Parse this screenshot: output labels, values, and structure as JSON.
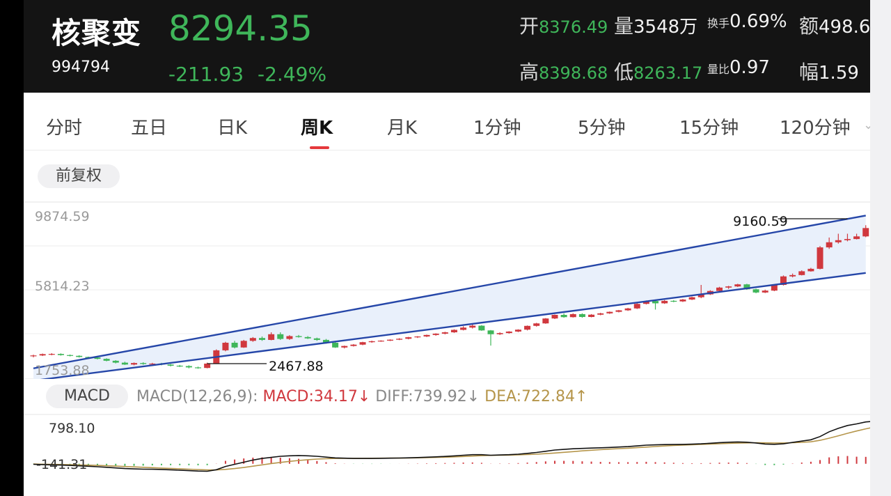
{
  "header": {
    "name": "核聚变",
    "code": "994794",
    "price": "8294.35",
    "change": "-211.93",
    "change_pct": "-2.49%",
    "stats": {
      "open_label": "开",
      "open_value": "8376.49",
      "volume_label": "量",
      "volume_value": "3548万",
      "turnover_label": "换手",
      "turnover_value": "0.69%",
      "amount_label": "额",
      "amount_value": "498.6",
      "high_label": "高",
      "high_value": "8398.68",
      "low_label": "低",
      "low_value": "8263.17",
      "vol_ratio_label": "量比",
      "vol_ratio_value": "0.97",
      "amplitude_label": "幅",
      "amplitude_value": "1.59"
    }
  },
  "tabs": [
    "分时",
    "五日",
    "日K",
    "周K",
    "月K",
    "1分钟",
    "5分钟",
    "15分钟",
    "120分钟"
  ],
  "active_tab": "周K",
  "adjust_label": "前复权",
  "macd_panel": {
    "button": "MACD",
    "params": "MACD(12,26,9):",
    "macd": "MACD:34.17",
    "diff": "DIFF:739.92",
    "dea": "DEA:722.84",
    "macd_color": "#d0383e",
    "diff_color": "#888888",
    "dea_color": "#b5954a"
  },
  "colors": {
    "up": "#d0383e",
    "down": "#3fb65a",
    "channel": "#2546a8",
    "channel_fill": "#e9f0fb"
  },
  "chart_data": [
    {
      "type": "candlestick",
      "title": "周K",
      "y_ticks": [
        "9874.59",
        "5814.23",
        "1753.88"
      ],
      "annotations": [
        {
          "text": "9160.59",
          "label": "high"
        },
        {
          "text": "2467.88",
          "label": "low"
        }
      ],
      "channel": {
        "lower": [
          [
            0,
            1150
          ],
          [
            91,
            6830
          ]
        ],
        "upper": [
          [
            0,
            1800
          ],
          [
            91,
            9860
          ]
        ]
      },
      "candles": [
        [
          2450,
          2480,
          2380,
          2520
        ],
        [
          2480,
          2550,
          2450,
          2580
        ],
        [
          2550,
          2560,
          2490,
          2600
        ],
        [
          2560,
          2500,
          2470,
          2590
        ],
        [
          2500,
          2460,
          2430,
          2530
        ],
        [
          2460,
          2400,
          2370,
          2490
        ],
        [
          2400,
          2370,
          2330,
          2420
        ],
        [
          2370,
          2300,
          2270,
          2400
        ],
        [
          2300,
          2200,
          2170,
          2330
        ],
        [
          2200,
          2100,
          2060,
          2230
        ],
        [
          2100,
          2000,
          1980,
          2150
        ],
        [
          2000,
          2080,
          1960,
          2110
        ],
        [
          2080,
          2030,
          1990,
          2120
        ],
        [
          2030,
          2050,
          1990,
          2090
        ],
        [
          2050,
          2000,
          1960,
          2090
        ],
        [
          2000,
          1940,
          1900,
          2030
        ],
        [
          1940,
          1920,
          1870,
          1980
        ],
        [
          1920,
          1850,
          1800,
          1960
        ],
        [
          1850,
          1820,
          1780,
          1890
        ],
        [
          1820,
          2050,
          1800,
          2100
        ],
        [
          2050,
          2750,
          2030,
          2800
        ],
        [
          2750,
          3150,
          2700,
          3200
        ],
        [
          3150,
          2900,
          2850,
          3250
        ],
        [
          2900,
          3250,
          2880,
          3300
        ],
        [
          3250,
          3400,
          3200,
          3450
        ],
        [
          3400,
          3300,
          3250,
          3480
        ],
        [
          3300,
          3600,
          3280,
          3700
        ],
        [
          3600,
          3350,
          3300,
          3700
        ],
        [
          3350,
          3500,
          3300,
          3550
        ],
        [
          3500,
          3450,
          3420,
          3560
        ],
        [
          3450,
          3380,
          3350,
          3500
        ],
        [
          3380,
          3300,
          3250,
          3420
        ],
        [
          3300,
          3150,
          3100,
          3350
        ],
        [
          3150,
          2900,
          2880,
          3180
        ],
        [
          2900,
          2980,
          2850,
          3000
        ],
        [
          2980,
          3050,
          2950,
          3080
        ],
        [
          3050,
          3180,
          3020,
          3200
        ],
        [
          3180,
          3230,
          3150,
          3260
        ],
        [
          3230,
          3260,
          3200,
          3280
        ],
        [
          3260,
          3310,
          3240,
          3330
        ],
        [
          3310,
          3360,
          3290,
          3390
        ],
        [
          3360,
          3440,
          3330,
          3460
        ],
        [
          3440,
          3480,
          3400,
          3500
        ],
        [
          3480,
          3560,
          3450,
          3580
        ],
        [
          3560,
          3630,
          3520,
          3650
        ],
        [
          3630,
          3700,
          3590,
          3730
        ],
        [
          3700,
          3830,
          3670,
          3860
        ],
        [
          3830,
          3950,
          3800,
          4020
        ],
        [
          3950,
          4050,
          3900,
          4120
        ],
        [
          4050,
          3800,
          3780,
          4080
        ],
        [
          3800,
          3600,
          3000,
          3820
        ],
        [
          3600,
          3660,
          3560,
          3700
        ],
        [
          3660,
          3740,
          3630,
          3760
        ],
        [
          3740,
          3840,
          3710,
          3860
        ],
        [
          3840,
          4040,
          3800,
          4060
        ],
        [
          4040,
          4170,
          4000,
          4200
        ],
        [
          4170,
          4430,
          4150,
          4450
        ],
        [
          4430,
          4620,
          4400,
          4640
        ],
        [
          4620,
          4500,
          4470,
          4700
        ],
        [
          4500,
          4660,
          4480,
          4700
        ],
        [
          4660,
          4510,
          4470,
          4700
        ],
        [
          4510,
          4630,
          4490,
          4660
        ],
        [
          4630,
          4700,
          4600,
          4730
        ],
        [
          4700,
          4780,
          4670,
          4800
        ],
        [
          4780,
          4860,
          4750,
          4880
        ],
        [
          4860,
          4960,
          4830,
          4990
        ],
        [
          4960,
          5200,
          4930,
          5230
        ],
        [
          5200,
          5350,
          5170,
          5380
        ],
        [
          5350,
          5230,
          4900,
          5400
        ],
        [
          5230,
          5360,
          5200,
          5400
        ],
        [
          5360,
          5330,
          5290,
          5400
        ],
        [
          5330,
          5430,
          5300,
          5460
        ],
        [
          5430,
          5550,
          5400,
          5580
        ],
        [
          5550,
          5700,
          5500,
          6200
        ],
        [
          5700,
          5880,
          5670,
          5920
        ],
        [
          5880,
          6060,
          5850,
          6100
        ],
        [
          6060,
          6120,
          5990,
          6150
        ],
        [
          6120,
          6230,
          6090,
          6260
        ],
        [
          6230,
          5970,
          5940,
          6260
        ],
        [
          5970,
          5800,
          5760,
          6000
        ],
        [
          5800,
          5900,
          5770,
          5950
        ],
        [
          5900,
          6200,
          5870,
          6230
        ],
        [
          6200,
          6650,
          6170,
          6700
        ],
        [
          6650,
          6720,
          6600,
          6800
        ],
        [
          6720,
          6920,
          6700,
          6970
        ],
        [
          6920,
          7050,
          6900,
          7100
        ],
        [
          7050,
          8180,
          7020,
          8250
        ],
        [
          8180,
          8450,
          8100,
          8700
        ],
        [
          8450,
          8560,
          8380,
          8900
        ],
        [
          8560,
          8620,
          8500,
          8900
        ],
        [
          8620,
          8760,
          8600,
          8900
        ],
        [
          8760,
          9200,
          8720,
          9350
        ],
        [
          9200,
          9180,
          9000,
          9380
        ],
        [
          9180,
          9050,
          8900,
          9300
        ],
        [
          9050,
          8294,
          8250,
          9100
        ]
      ]
    },
    {
      "type": "line",
      "title": "MACD(12,26,9)",
      "y_ticks": [
        "798.10",
        "-141.31"
      ],
      "ylim": [
        -160,
        820
      ],
      "series": [
        {
          "name": "DIFF",
          "color": "#111111",
          "values": [
            -10,
            -15,
            -20,
            -24,
            -30,
            -38,
            -46,
            -55,
            -66,
            -78,
            -90,
            -96,
            -101,
            -103,
            -107,
            -113,
            -120,
            -128,
            -136,
            -141,
            -112,
            -50,
            -10,
            30,
            70,
            100,
            120,
            140,
            150,
            155,
            150,
            140,
            125,
            110,
            105,
            100,
            100,
            100,
            102,
            105,
            108,
            112,
            117,
            123,
            130,
            138,
            148,
            160,
            170,
            170,
            160,
            165,
            170,
            180,
            195,
            212,
            235,
            258,
            270,
            282,
            288,
            295,
            300,
            307,
            314,
            322,
            335,
            350,
            355,
            360,
            362,
            364,
            368,
            375,
            385,
            397,
            405,
            410,
            405,
            390,
            370,
            365,
            375,
            400,
            425,
            450,
            510,
            600,
            665,
            718,
            748,
            785,
            798,
            790,
            740
          ]
        },
        {
          "name": "DEA",
          "color": "#b5954a",
          "values": [
            -5,
            -8,
            -11,
            -14,
            -17,
            -21,
            -26,
            -31,
            -37,
            -44,
            -51,
            -58,
            -66,
            -73,
            -80,
            -87,
            -94,
            -101,
            -108,
            -115,
            -115,
            -105,
            -90,
            -70,
            -45,
            -20,
            5,
            25,
            45,
            62,
            77,
            88,
            95,
            100,
            102,
            103,
            103,
            104,
            105,
            106,
            107,
            109,
            112,
            115,
            119,
            124,
            130,
            137,
            145,
            152,
            157,
            160,
            163,
            167,
            173,
            180,
            190,
            202,
            215,
            228,
            242,
            254,
            265,
            275,
            284,
            292,
            302,
            313,
            324,
            334,
            343,
            351,
            358,
            364,
            370,
            376,
            382,
            388,
            392,
            394,
            393,
            390,
            390,
            395,
            402,
            412,
            440,
            480,
            525,
            572,
            615,
            655,
            690,
            712,
            722
          ]
        },
        {
          "name": "MACD",
          "color": "#d0383e",
          "type": "bar",
          "values": [
            -5,
            -7,
            -9,
            -10,
            -13,
            -17,
            -20,
            -24,
            -29,
            -34,
            -39,
            -38,
            -35,
            -30,
            -27,
            -26,
            -26,
            -27,
            -28,
            -26,
            3,
            55,
            80,
            100,
            115,
            120,
            115,
            115,
            105,
            93,
            73,
            52,
            30,
            10,
            3,
            -3,
            -3,
            -4,
            -3,
            -1,
            1,
            3,
            5,
            8,
            11,
            14,
            18,
            23,
            25,
            18,
            3,
            5,
            7,
            13,
            22,
            32,
            45,
            56,
            55,
            54,
            46,
            41,
            35,
            32,
            30,
            30,
            33,
            37,
            31,
            26,
            19,
            13,
            10,
            11,
            15,
            21,
            23,
            22,
            13,
            -4,
            -23,
            -25,
            -15,
            5,
            23,
            38,
            70,
            120,
            140,
            146,
            133,
            130,
            108,
            78,
            18
          ]
        }
      ]
    }
  ]
}
